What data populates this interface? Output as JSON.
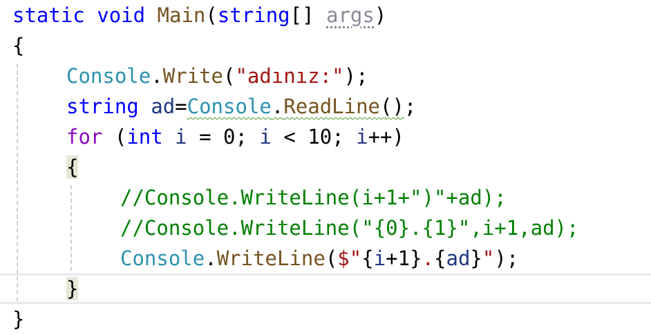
{
  "colors": {
    "keyword": "#0000ff",
    "control_keyword": "#8f08c4",
    "type": "#2b91af",
    "method": "#74531f",
    "string": "#a31515",
    "comment": "#008000",
    "parameter": "#8a8a9a",
    "local": "#1f377f",
    "number": "#000000",
    "plain": "#000000",
    "indent_guide": "#d0d0d0",
    "brace_highlight": "#e4e8d8"
  },
  "lines": [
    {
      "indent": 0,
      "tokens": [
        {
          "text": "static",
          "kind": "keyword"
        },
        {
          "text": " ",
          "kind": "plain"
        },
        {
          "text": "void",
          "kind": "keyword"
        },
        {
          "text": " ",
          "kind": "plain"
        },
        {
          "text": "Main",
          "kind": "method"
        },
        {
          "text": "(",
          "kind": "plain"
        },
        {
          "text": "string",
          "kind": "keyword"
        },
        {
          "text": "[] ",
          "kind": "plain"
        },
        {
          "text": "args",
          "kind": "parameter",
          "decor": "unused-dots"
        },
        {
          "text": ")",
          "kind": "plain"
        }
      ]
    },
    {
      "indent": 0,
      "tokens": [
        {
          "text": "{",
          "kind": "plain"
        }
      ]
    },
    {
      "indent": 1,
      "tokens": [
        {
          "text": "Console",
          "kind": "type"
        },
        {
          "text": ".",
          "kind": "plain"
        },
        {
          "text": "Write",
          "kind": "method"
        },
        {
          "text": "(",
          "kind": "plain"
        },
        {
          "text": "\"adınız:\"",
          "kind": "string"
        },
        {
          "text": ");",
          "kind": "plain"
        }
      ]
    },
    {
      "indent": 1,
      "tokens": [
        {
          "text": "string",
          "kind": "keyword"
        },
        {
          "text": " ",
          "kind": "plain"
        },
        {
          "text": "ad",
          "kind": "local"
        },
        {
          "text": "=",
          "kind": "plain"
        },
        {
          "text": "Console",
          "kind": "type",
          "decor": "squiggle"
        },
        {
          "text": ".",
          "kind": "plain",
          "decor": "squiggle"
        },
        {
          "text": "ReadLine",
          "kind": "method",
          "decor": "squiggle"
        },
        {
          "text": "()",
          "kind": "plain",
          "decor": "squiggle"
        },
        {
          "text": ";",
          "kind": "plain"
        }
      ]
    },
    {
      "indent": 1,
      "tokens": [
        {
          "text": "for",
          "kind": "control_keyword"
        },
        {
          "text": " (",
          "kind": "plain"
        },
        {
          "text": "int",
          "kind": "keyword"
        },
        {
          "text": " ",
          "kind": "plain"
        },
        {
          "text": "i",
          "kind": "local"
        },
        {
          "text": " = ",
          "kind": "plain"
        },
        {
          "text": "0",
          "kind": "number"
        },
        {
          "text": "; ",
          "kind": "plain"
        },
        {
          "text": "i",
          "kind": "local"
        },
        {
          "text": " < ",
          "kind": "plain"
        },
        {
          "text": "10",
          "kind": "number"
        },
        {
          "text": "; ",
          "kind": "plain"
        },
        {
          "text": "i",
          "kind": "local"
        },
        {
          "text": "++)",
          "kind": "plain"
        }
      ]
    },
    {
      "indent": 1,
      "tokens": [
        {
          "text": "{",
          "kind": "plain",
          "decor": "brace-hl"
        }
      ]
    },
    {
      "indent": 2,
      "tokens": [
        {
          "text": "//Console.WriteLine(i+1+\")\"+ad);",
          "kind": "comment"
        }
      ]
    },
    {
      "indent": 2,
      "tokens": [
        {
          "text": "//Console.WriteLine(\"{0}.{1}\",i+1,ad);",
          "kind": "comment"
        }
      ]
    },
    {
      "indent": 2,
      "tokens": [
        {
          "text": "Console",
          "kind": "type"
        },
        {
          "text": ".",
          "kind": "plain"
        },
        {
          "text": "WriteLine",
          "kind": "method"
        },
        {
          "text": "(",
          "kind": "plain"
        },
        {
          "text": "$\"",
          "kind": "string"
        },
        {
          "text": "{",
          "kind": "plain"
        },
        {
          "text": "i",
          "kind": "local"
        },
        {
          "text": "+",
          "kind": "plain"
        },
        {
          "text": "1",
          "kind": "number"
        },
        {
          "text": "}",
          "kind": "plain"
        },
        {
          "text": ".",
          "kind": "string"
        },
        {
          "text": "{",
          "kind": "plain"
        },
        {
          "text": "ad",
          "kind": "local"
        },
        {
          "text": "}",
          "kind": "plain"
        },
        {
          "text": "\"",
          "kind": "string"
        },
        {
          "text": ");",
          "kind": "plain"
        }
      ]
    },
    {
      "indent": 1,
      "current": true,
      "tokens": [
        {
          "text": "}",
          "kind": "plain",
          "decor": "brace-hl"
        }
      ]
    },
    {
      "indent": 0,
      "tokens": [
        {
          "text": "}",
          "kind": "plain"
        }
      ]
    }
  ]
}
